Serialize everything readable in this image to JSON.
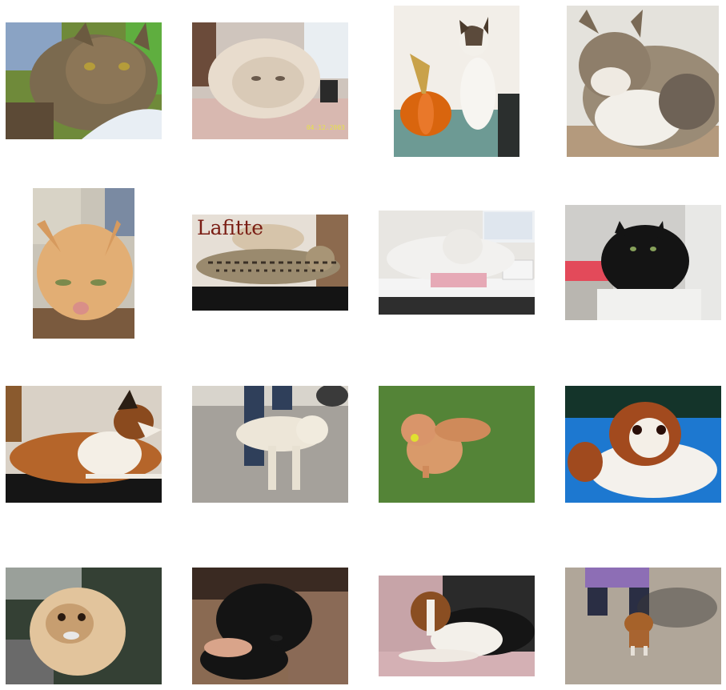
{
  "gallery": {
    "photos": [
      {
        "id": "cat-tabby-green-bed",
        "subject": "cat",
        "text": ""
      },
      {
        "id": "cat-fluffy-persian",
        "subject": "cat",
        "text": "04.12.2003"
      },
      {
        "id": "cat-kitten-pumpkin",
        "subject": "cat",
        "text": ""
      },
      {
        "id": "cat-longhair-sleeping",
        "subject": "cat",
        "text": ""
      },
      {
        "id": "cat-orange-closeup",
        "subject": "cat",
        "text": ""
      },
      {
        "id": "cat-bengal-lafitte",
        "subject": "cat",
        "text": "Lafitte"
      },
      {
        "id": "cat-white-desk",
        "subject": "cat",
        "text": ""
      },
      {
        "id": "cat-black-litter",
        "subject": "cat",
        "text": ""
      },
      {
        "id": "dog-sheltie-lying",
        "subject": "dog",
        "text": ""
      },
      {
        "id": "dog-yellow-lab-puppy",
        "subject": "dog",
        "text": ""
      },
      {
        "id": "dog-golden-ball-grass",
        "subject": "dog",
        "text": ""
      },
      {
        "id": "dog-japanese-chin",
        "subject": "dog",
        "text": ""
      },
      {
        "id": "dog-pekingese-lap",
        "subject": "dog",
        "text": ""
      },
      {
        "id": "dog-black-puppy-held",
        "subject": "dog",
        "text": ""
      },
      {
        "id": "dog-beagle-blanket",
        "subject": "dog",
        "text": ""
      },
      {
        "id": "dog-small-gravel",
        "subject": "dog",
        "text": ""
      }
    ]
  }
}
